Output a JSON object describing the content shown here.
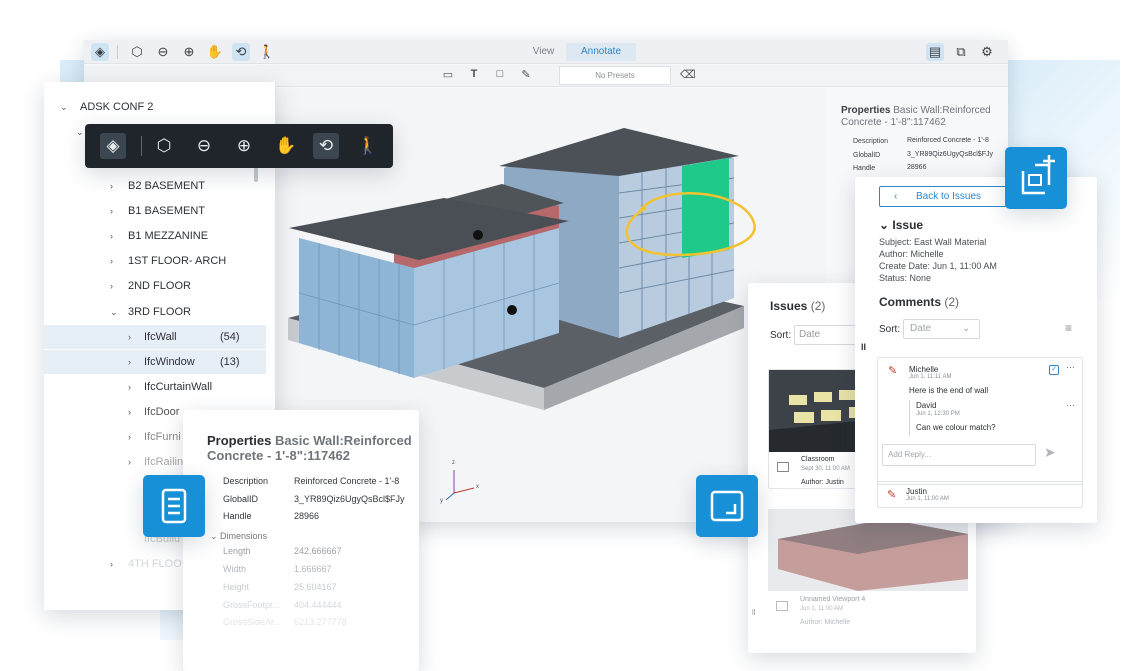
{
  "viewer": {
    "tabs": [
      "View",
      "Annotate"
    ],
    "active_tab": "Annotate",
    "presets": "No Presets"
  },
  "tree": {
    "root": "ADSK CONF 2",
    "items": [
      {
        "label": "B2 BASEMENT"
      },
      {
        "label": "B1 BASEMENT"
      },
      {
        "label": "B1 MEZZANINE"
      },
      {
        "label": "1ST FLOOR- ARCH"
      },
      {
        "label": "2ND FLOOR"
      },
      {
        "label": "3RD FLOOR"
      }
    ],
    "children": [
      {
        "label": "IfcWall",
        "count": "(54)"
      },
      {
        "label": "IfcWindow",
        "count": "(13)"
      },
      {
        "label": "IfcCurtainWall",
        "count": ""
      },
      {
        "label": "IfcDoor",
        "count": ""
      },
      {
        "label": "IfcFurni",
        "count": ""
      },
      {
        "label": "IfcRailin",
        "count": ""
      }
    ],
    "faded": [
      "IfcBuild",
      "4TH FLOO"
    ]
  },
  "properties_card": {
    "title_bold": "Properties",
    "title_rest": "Basic Wall:Reinforced Concrete - 1'-8\":117462",
    "rows": [
      {
        "key": "Description",
        "value": "Reinforced Concrete - 1'-8"
      },
      {
        "key": "GlobalID",
        "value": "3_YR89Qiz6UgyQsBcl$FJy"
      },
      {
        "key": "Handle",
        "value": "28966"
      }
    ],
    "section": "Dimensions",
    "dims": [
      {
        "key": "Length",
        "value": "242.666667"
      },
      {
        "key": "Width",
        "value": "1.666667"
      },
      {
        "key": "Height",
        "value": "25.604167"
      },
      {
        "key": "GrossFootpr...",
        "value": "404.444444"
      },
      {
        "key": "GrossSideAr...",
        "value": "6213.277778"
      }
    ]
  },
  "right_props": {
    "title_bold": "Properties",
    "title_rest": "Basic Wall:Reinforced Concrete - 1'-8\":117462",
    "rows": [
      {
        "key": "Description",
        "value": "Reinforced Concrete - 1'-8"
      },
      {
        "key": "GlobalID",
        "value": "3_YR89Qiz6UgyQsBcl$FJy"
      },
      {
        "key": "Handle",
        "value": "28966"
      }
    ]
  },
  "axes": {
    "x": "x",
    "y": "y",
    "z": "z"
  },
  "issues_panel": {
    "title": "Issues",
    "count": "(2)",
    "sort_label": "Sort:",
    "sort_value": "Date",
    "cards": [
      {
        "name": "Classroom",
        "date": "Sept 30, 11:00 AM",
        "author": "Author: Justin"
      },
      {
        "name": "Unnamed Viewport 4",
        "date": "Jun 1, 11:00 AM",
        "author": "Author: Michelle"
      }
    ]
  },
  "detail": {
    "back": "Back to Issues",
    "heading": "Issue",
    "subject": "Subject: East Wall Material",
    "author": "Author: Michelle",
    "create_date": "Create Date: Jun 1, 11:00 AM",
    "status": "Status: None",
    "comments_title": "Comments",
    "comments_count": "(2)",
    "sort_label": "Sort:",
    "sort_value": "Date",
    "comment": {
      "author": "Michelle",
      "date": "Jun 1, 11:11 AM",
      "text": "Here is the end of wall"
    },
    "reply": {
      "author": "David",
      "date": "Jun 1, 12:30 PM",
      "text": "Can we colour match?"
    },
    "reply_placeholder": "Add Reply...",
    "comment2": {
      "author": "Justin",
      "date": "Jun 1, 11:00 AM"
    }
  },
  "colors": {
    "accent": "#1890d8",
    "annotation": "#f2c230",
    "highlight_panel": "#1ec98a"
  }
}
